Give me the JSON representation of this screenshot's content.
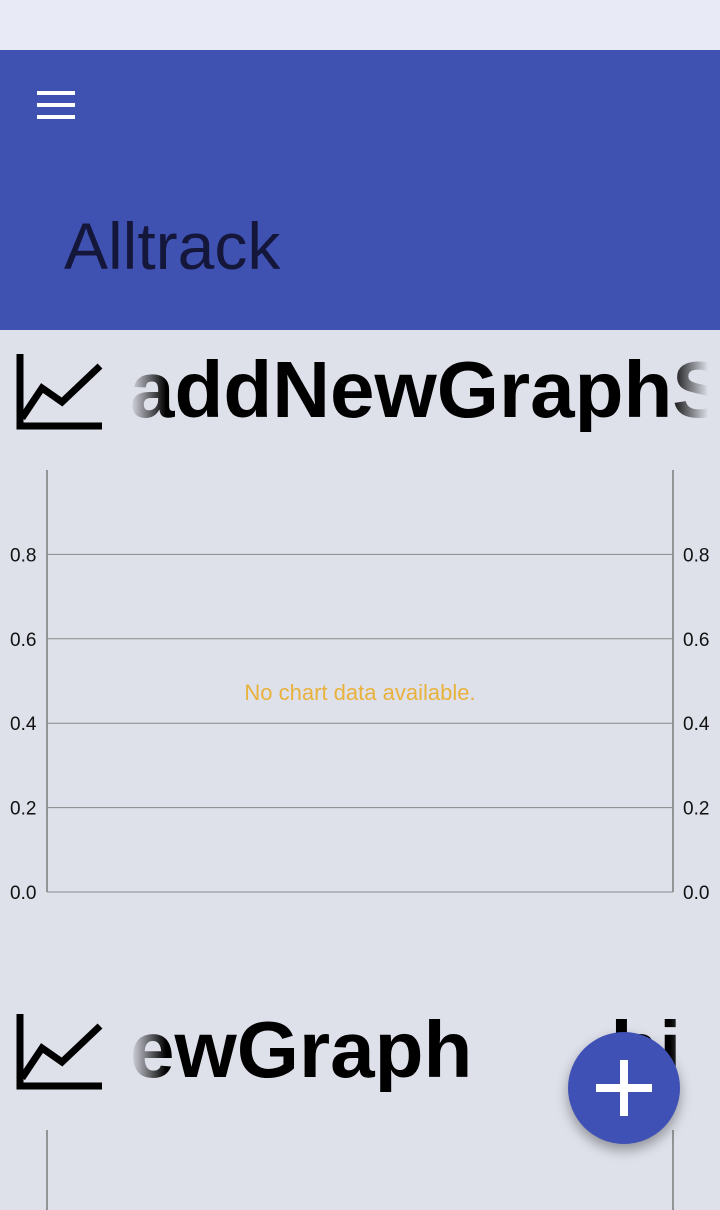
{
  "app_bar": {
    "title": "Alltrack",
    "menu_icon": "hamburger-menu-icon",
    "background": "#3f51b1"
  },
  "graphs": [
    {
      "title": "addNewGraphSh",
      "icon": "line-chart-icon",
      "chart_data": {
        "type": "line",
        "series": [],
        "left_ticks": [
          "0.8",
          "0.6",
          "0.4",
          "0.2",
          "0.0"
        ],
        "right_ticks": [
          "0.8",
          "0.6",
          "0.4",
          "0.2",
          "0.0"
        ],
        "ylim": [
          0,
          1
        ],
        "grid": true,
        "empty_message": "No chart data available.",
        "empty_message_color": "#e8b23c"
      }
    },
    {
      "title_left": "ewGraph",
      "title_right": "hi",
      "icon": "line-chart-icon"
    }
  ],
  "fab": {
    "icon": "plus-icon",
    "color": "#3f51b5"
  }
}
